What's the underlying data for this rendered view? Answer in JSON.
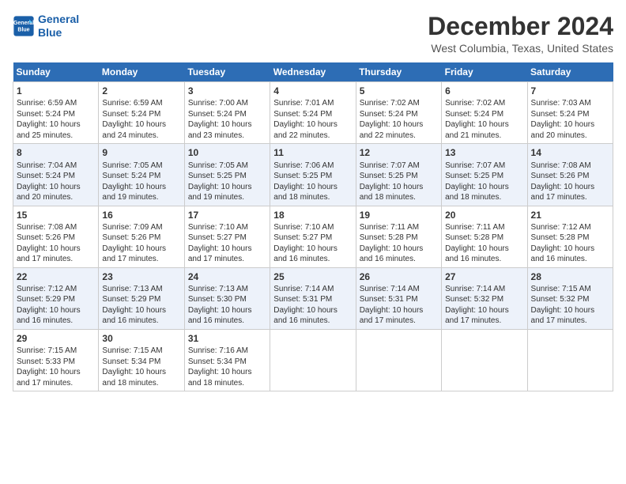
{
  "header": {
    "logo_line1": "General",
    "logo_line2": "Blue",
    "month_title": "December 2024",
    "location": "West Columbia, Texas, United States"
  },
  "days_of_week": [
    "Sunday",
    "Monday",
    "Tuesday",
    "Wednesday",
    "Thursday",
    "Friday",
    "Saturday"
  ],
  "weeks": [
    [
      {
        "day": "1",
        "info": "Sunrise: 6:59 AM\nSunset: 5:24 PM\nDaylight: 10 hours\nand 25 minutes."
      },
      {
        "day": "2",
        "info": "Sunrise: 6:59 AM\nSunset: 5:24 PM\nDaylight: 10 hours\nand 24 minutes."
      },
      {
        "day": "3",
        "info": "Sunrise: 7:00 AM\nSunset: 5:24 PM\nDaylight: 10 hours\nand 23 minutes."
      },
      {
        "day": "4",
        "info": "Sunrise: 7:01 AM\nSunset: 5:24 PM\nDaylight: 10 hours\nand 22 minutes."
      },
      {
        "day": "5",
        "info": "Sunrise: 7:02 AM\nSunset: 5:24 PM\nDaylight: 10 hours\nand 22 minutes."
      },
      {
        "day": "6",
        "info": "Sunrise: 7:02 AM\nSunset: 5:24 PM\nDaylight: 10 hours\nand 21 minutes."
      },
      {
        "day": "7",
        "info": "Sunrise: 7:03 AM\nSunset: 5:24 PM\nDaylight: 10 hours\nand 20 minutes."
      }
    ],
    [
      {
        "day": "8",
        "info": "Sunrise: 7:04 AM\nSunset: 5:24 PM\nDaylight: 10 hours\nand 20 minutes."
      },
      {
        "day": "9",
        "info": "Sunrise: 7:05 AM\nSunset: 5:24 PM\nDaylight: 10 hours\nand 19 minutes."
      },
      {
        "day": "10",
        "info": "Sunrise: 7:05 AM\nSunset: 5:25 PM\nDaylight: 10 hours\nand 19 minutes."
      },
      {
        "day": "11",
        "info": "Sunrise: 7:06 AM\nSunset: 5:25 PM\nDaylight: 10 hours\nand 18 minutes."
      },
      {
        "day": "12",
        "info": "Sunrise: 7:07 AM\nSunset: 5:25 PM\nDaylight: 10 hours\nand 18 minutes."
      },
      {
        "day": "13",
        "info": "Sunrise: 7:07 AM\nSunset: 5:25 PM\nDaylight: 10 hours\nand 18 minutes."
      },
      {
        "day": "14",
        "info": "Sunrise: 7:08 AM\nSunset: 5:26 PM\nDaylight: 10 hours\nand 17 minutes."
      }
    ],
    [
      {
        "day": "15",
        "info": "Sunrise: 7:08 AM\nSunset: 5:26 PM\nDaylight: 10 hours\nand 17 minutes."
      },
      {
        "day": "16",
        "info": "Sunrise: 7:09 AM\nSunset: 5:26 PM\nDaylight: 10 hours\nand 17 minutes."
      },
      {
        "day": "17",
        "info": "Sunrise: 7:10 AM\nSunset: 5:27 PM\nDaylight: 10 hours\nand 17 minutes."
      },
      {
        "day": "18",
        "info": "Sunrise: 7:10 AM\nSunset: 5:27 PM\nDaylight: 10 hours\nand 16 minutes."
      },
      {
        "day": "19",
        "info": "Sunrise: 7:11 AM\nSunset: 5:28 PM\nDaylight: 10 hours\nand 16 minutes."
      },
      {
        "day": "20",
        "info": "Sunrise: 7:11 AM\nSunset: 5:28 PM\nDaylight: 10 hours\nand 16 minutes."
      },
      {
        "day": "21",
        "info": "Sunrise: 7:12 AM\nSunset: 5:28 PM\nDaylight: 10 hours\nand 16 minutes."
      }
    ],
    [
      {
        "day": "22",
        "info": "Sunrise: 7:12 AM\nSunset: 5:29 PM\nDaylight: 10 hours\nand 16 minutes."
      },
      {
        "day": "23",
        "info": "Sunrise: 7:13 AM\nSunset: 5:29 PM\nDaylight: 10 hours\nand 16 minutes."
      },
      {
        "day": "24",
        "info": "Sunrise: 7:13 AM\nSunset: 5:30 PM\nDaylight: 10 hours\nand 16 minutes."
      },
      {
        "day": "25",
        "info": "Sunrise: 7:14 AM\nSunset: 5:31 PM\nDaylight: 10 hours\nand 16 minutes."
      },
      {
        "day": "26",
        "info": "Sunrise: 7:14 AM\nSunset: 5:31 PM\nDaylight: 10 hours\nand 17 minutes."
      },
      {
        "day": "27",
        "info": "Sunrise: 7:14 AM\nSunset: 5:32 PM\nDaylight: 10 hours\nand 17 minutes."
      },
      {
        "day": "28",
        "info": "Sunrise: 7:15 AM\nSunset: 5:32 PM\nDaylight: 10 hours\nand 17 minutes."
      }
    ],
    [
      {
        "day": "29",
        "info": "Sunrise: 7:15 AM\nSunset: 5:33 PM\nDaylight: 10 hours\nand 17 minutes."
      },
      {
        "day": "30",
        "info": "Sunrise: 7:15 AM\nSunset: 5:34 PM\nDaylight: 10 hours\nand 18 minutes."
      },
      {
        "day": "31",
        "info": "Sunrise: 7:16 AM\nSunset: 5:34 PM\nDaylight: 10 hours\nand 18 minutes."
      },
      {
        "day": "",
        "info": ""
      },
      {
        "day": "",
        "info": ""
      },
      {
        "day": "",
        "info": ""
      },
      {
        "day": "",
        "info": ""
      }
    ]
  ]
}
